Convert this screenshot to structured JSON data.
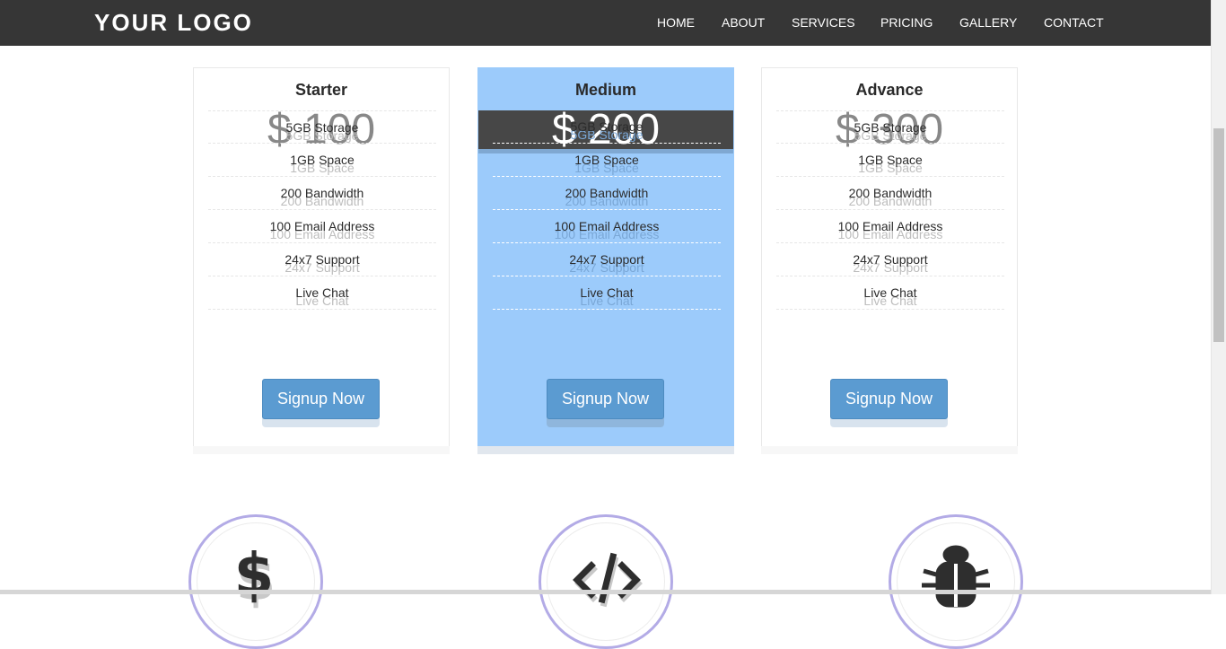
{
  "header": {
    "logo": "YOUR LOGO",
    "nav": [
      "HOME",
      "ABOUT",
      "SERVICES",
      "PRICING",
      "GALLERY",
      "CONTACT"
    ]
  },
  "plans": [
    {
      "name": "Starter",
      "price": "$ 100",
      "features": [
        "5GB Storage",
        "1GB Space",
        "200 Bandwidth",
        "100 Email Address",
        "24x7 Support",
        "Live Chat"
      ],
      "button": "Signup Now"
    },
    {
      "name": "Medium",
      "price": "$ 200",
      "features": [
        "5GB Storage",
        "1GB Space",
        "200 Bandwidth",
        "100 Email Address",
        "24x7 Support",
        "Live Chat"
      ],
      "button": "Signup Now"
    },
    {
      "name": "Advance",
      "price": "$ 300",
      "features": [
        "5GB Storage",
        "1GB Space",
        "200 Bandwidth",
        "100 Email Address",
        "24x7 Support",
        "Live Chat"
      ],
      "button": "Signup Now"
    }
  ],
  "features_icons": [
    "dollar-icon",
    "code-icon",
    "bug-icon"
  ],
  "colors": {
    "navbar": "#363636",
    "featured_plan": "#9ccbfb",
    "button": "#5b9bd1",
    "circle_border": "#b3abe6"
  }
}
